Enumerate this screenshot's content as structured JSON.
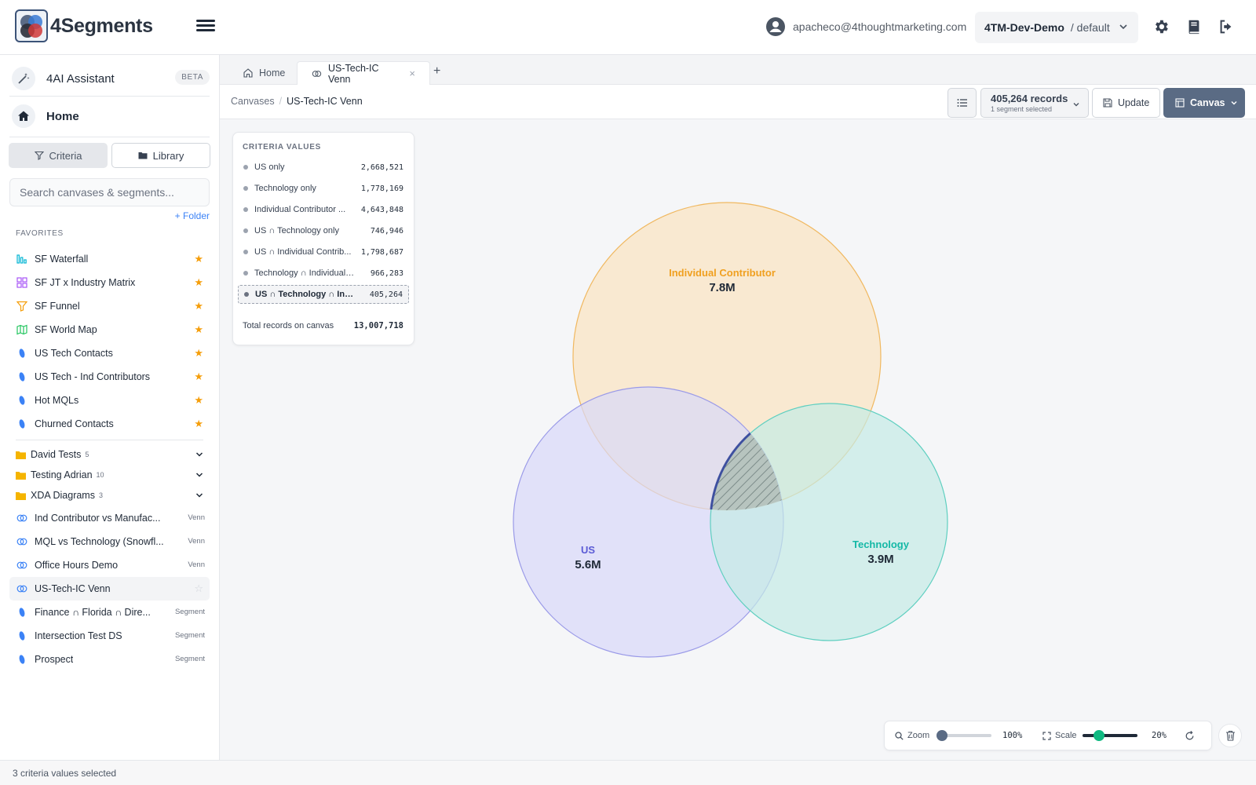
{
  "app": {
    "name": "4Segments"
  },
  "header": {
    "user_email": "apacheco@4thoughtmarketing.com",
    "env_name": "4TM-Dev-Demo",
    "env_space": "/ default"
  },
  "sidebar": {
    "assistant_label": "4AI Assistant",
    "assistant_badge": "BETA",
    "home_label": "Home",
    "tabs": {
      "criteria": "Criteria",
      "library": "Library"
    },
    "search_placeholder": "Search canvases & segments...",
    "add_folder": "+ Folder",
    "favorites_heading": "FAVORITES",
    "favorites": [
      {
        "label": "SF Waterfall",
        "icon": "waterfall-chart-icon",
        "color": "#06b6d4"
      },
      {
        "label": "SF JT x Industry Matrix",
        "icon": "matrix-grid-icon",
        "color": "#a855f7"
      },
      {
        "label": "SF Funnel",
        "icon": "funnel-icon",
        "color": "#f59e0b"
      },
      {
        "label": "SF World Map",
        "icon": "map-icon",
        "color": "#22c55e"
      },
      {
        "label": "US Tech Contacts",
        "icon": "segment-icon",
        "color": "#3b82f6"
      },
      {
        "label": "US Tech - Ind Contributors",
        "icon": "segment-icon",
        "color": "#3b82f6"
      },
      {
        "label": "Hot MQLs",
        "icon": "segment-icon",
        "color": "#3b82f6"
      },
      {
        "label": "Churned Contacts",
        "icon": "segment-icon",
        "color": "#3b82f6"
      }
    ],
    "folders": [
      {
        "label": "David Tests",
        "count": "5"
      },
      {
        "label": "Testing Adrian",
        "count": "10"
      },
      {
        "label": "XDA Diagrams",
        "count": "3"
      }
    ],
    "items": [
      {
        "label": "Ind Contributor vs Manufac...",
        "type": "Venn"
      },
      {
        "label": "MQL vs Technology (Snowfl...",
        "type": "Venn"
      },
      {
        "label": "Office Hours Demo",
        "type": "Venn"
      },
      {
        "label": "US-Tech-IC Venn",
        "type": ""
      },
      {
        "label": "Finance ∩ Florida ∩ Dire...",
        "type": "Segment"
      },
      {
        "label": "Intersection Test DS",
        "type": "Segment"
      },
      {
        "label": "Prospect",
        "type": "Segment"
      }
    ]
  },
  "tabs": [
    {
      "label": "Home"
    },
    {
      "label": "US-Tech-IC Venn"
    }
  ],
  "toolbar": {
    "crumb_root": "Canvases",
    "crumb_sep": "/",
    "crumb_current": "US-Tech-IC Venn",
    "records": "405,264 records",
    "records_sub": "1 segment selected",
    "update": "Update",
    "canvas": "Canvas"
  },
  "criteria": {
    "heading": "CRITERIA VALUES",
    "rows": [
      {
        "label": "US only",
        "value": "2,668,521"
      },
      {
        "label": "Technology only",
        "value": "1,778,169"
      },
      {
        "label": "Individual Contributor ...",
        "value": "4,643,848"
      },
      {
        "label": "US ∩ Technology only",
        "value": "746,946"
      },
      {
        "label": "US ∩ Individual Contrib...",
        "value": "1,798,687"
      },
      {
        "label": "Technology ∩ Individual C...",
        "value": "966,283"
      },
      {
        "label": "US ∩ Technology ∩ Indi...",
        "value": "405,264"
      }
    ],
    "total_label": "Total records on canvas",
    "total_value": "13,007,718"
  },
  "venn": {
    "sets": [
      {
        "name": "Individual Contributor",
        "value": "7.8M",
        "color": "#f0a020",
        "fill": "#f9e4c4"
      },
      {
        "name": "US",
        "value": "5.6M",
        "color": "#5b5bd6",
        "fill": "#d9d9fa"
      },
      {
        "name": "Technology",
        "value": "3.9M",
        "color": "#14b8a6",
        "fill": "#c4ebe6"
      }
    ]
  },
  "zoom": {
    "zoom_label": "Zoom",
    "zoom_value": "100%",
    "scale_label": "Scale",
    "scale_value": "20%",
    "zoom_level": 0.0,
    "scale_level": 0.25
  },
  "status": "3 criteria values selected"
}
